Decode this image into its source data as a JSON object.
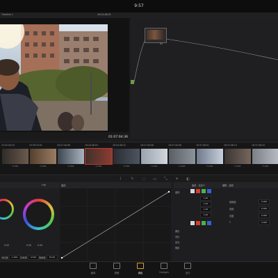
{
  "window": {
    "title": "9:57"
  },
  "viewer": {
    "clip_name": "Timeline 1",
    "source_tc": "16:24:48:03",
    "timecode": "01:07:04:36"
  },
  "node_graph": {
    "node_label": "01"
  },
  "clips": [
    {
      "index": "01",
      "tc": "15:32:04:24",
      "codec": "H.264"
    },
    {
      "index": "02",
      "tc": "15:39:23:41",
      "codec": "H.264"
    },
    {
      "index": "03",
      "tc": "16:37:44:08",
      "codec": "H.264"
    },
    {
      "index": "04",
      "tc": "16:24:48:03",
      "codec": "H.264"
    },
    {
      "index": "05",
      "tc": "16:24:46:22",
      "codec": "H.264"
    },
    {
      "index": "06",
      "tc": "16:27:44:58",
      "codec": "H.264"
    },
    {
      "index": "07",
      "tc": "16:37:44:58",
      "codec": "H.264"
    },
    {
      "index": "08",
      "tc": "16:37:48:01",
      "codec": "H.264"
    },
    {
      "index": "09",
      "tc": "16:37:48:15",
      "codec": "H.264"
    },
    {
      "index": "10",
      "tc": "16:37:48:16",
      "codec": "H.264"
    }
  ],
  "panels": {
    "wheels_title": "Log",
    "curves_title": "曲线",
    "rgb_title": "曲线 - 自定义",
    "rgb_side_title": "编辑 - 曲线",
    "wheel_values": [
      "0.00",
      "0.00",
      "0.00",
      "0.00"
    ],
    "rows": [
      {
        "label": "曲线",
        "value": "1.00"
      },
      {
        "label": "",
        "value": "1.00"
      },
      {
        "label": "",
        "value": "1.00"
      },
      {
        "label": "",
        "value": "1.00"
      }
    ],
    "side_rows": [
      {
        "label": "饱和度",
        "value": "0.000"
      },
      {
        "label": "色相",
        "value": "0.000"
      },
      {
        "label": "亮度",
        "value": "0.000"
      },
      {
        "label": "Y",
        "value": "0.000"
      }
    ],
    "mix_labels": [
      "柔化",
      "对比",
      "高光",
      "阴影"
    ],
    "footer": [
      "对比度",
      "1.000",
      "中间调",
      "0.524",
      "饱和度",
      "50.00"
    ]
  },
  "bottom_nav": [
    "媒体",
    "剪辑",
    "调色",
    "Fairlight",
    "交付"
  ],
  "active_page": "调色",
  "colors": {
    "accent": "#d8a038",
    "selection": "#c8372c",
    "node_input": "#6d9a48"
  }
}
